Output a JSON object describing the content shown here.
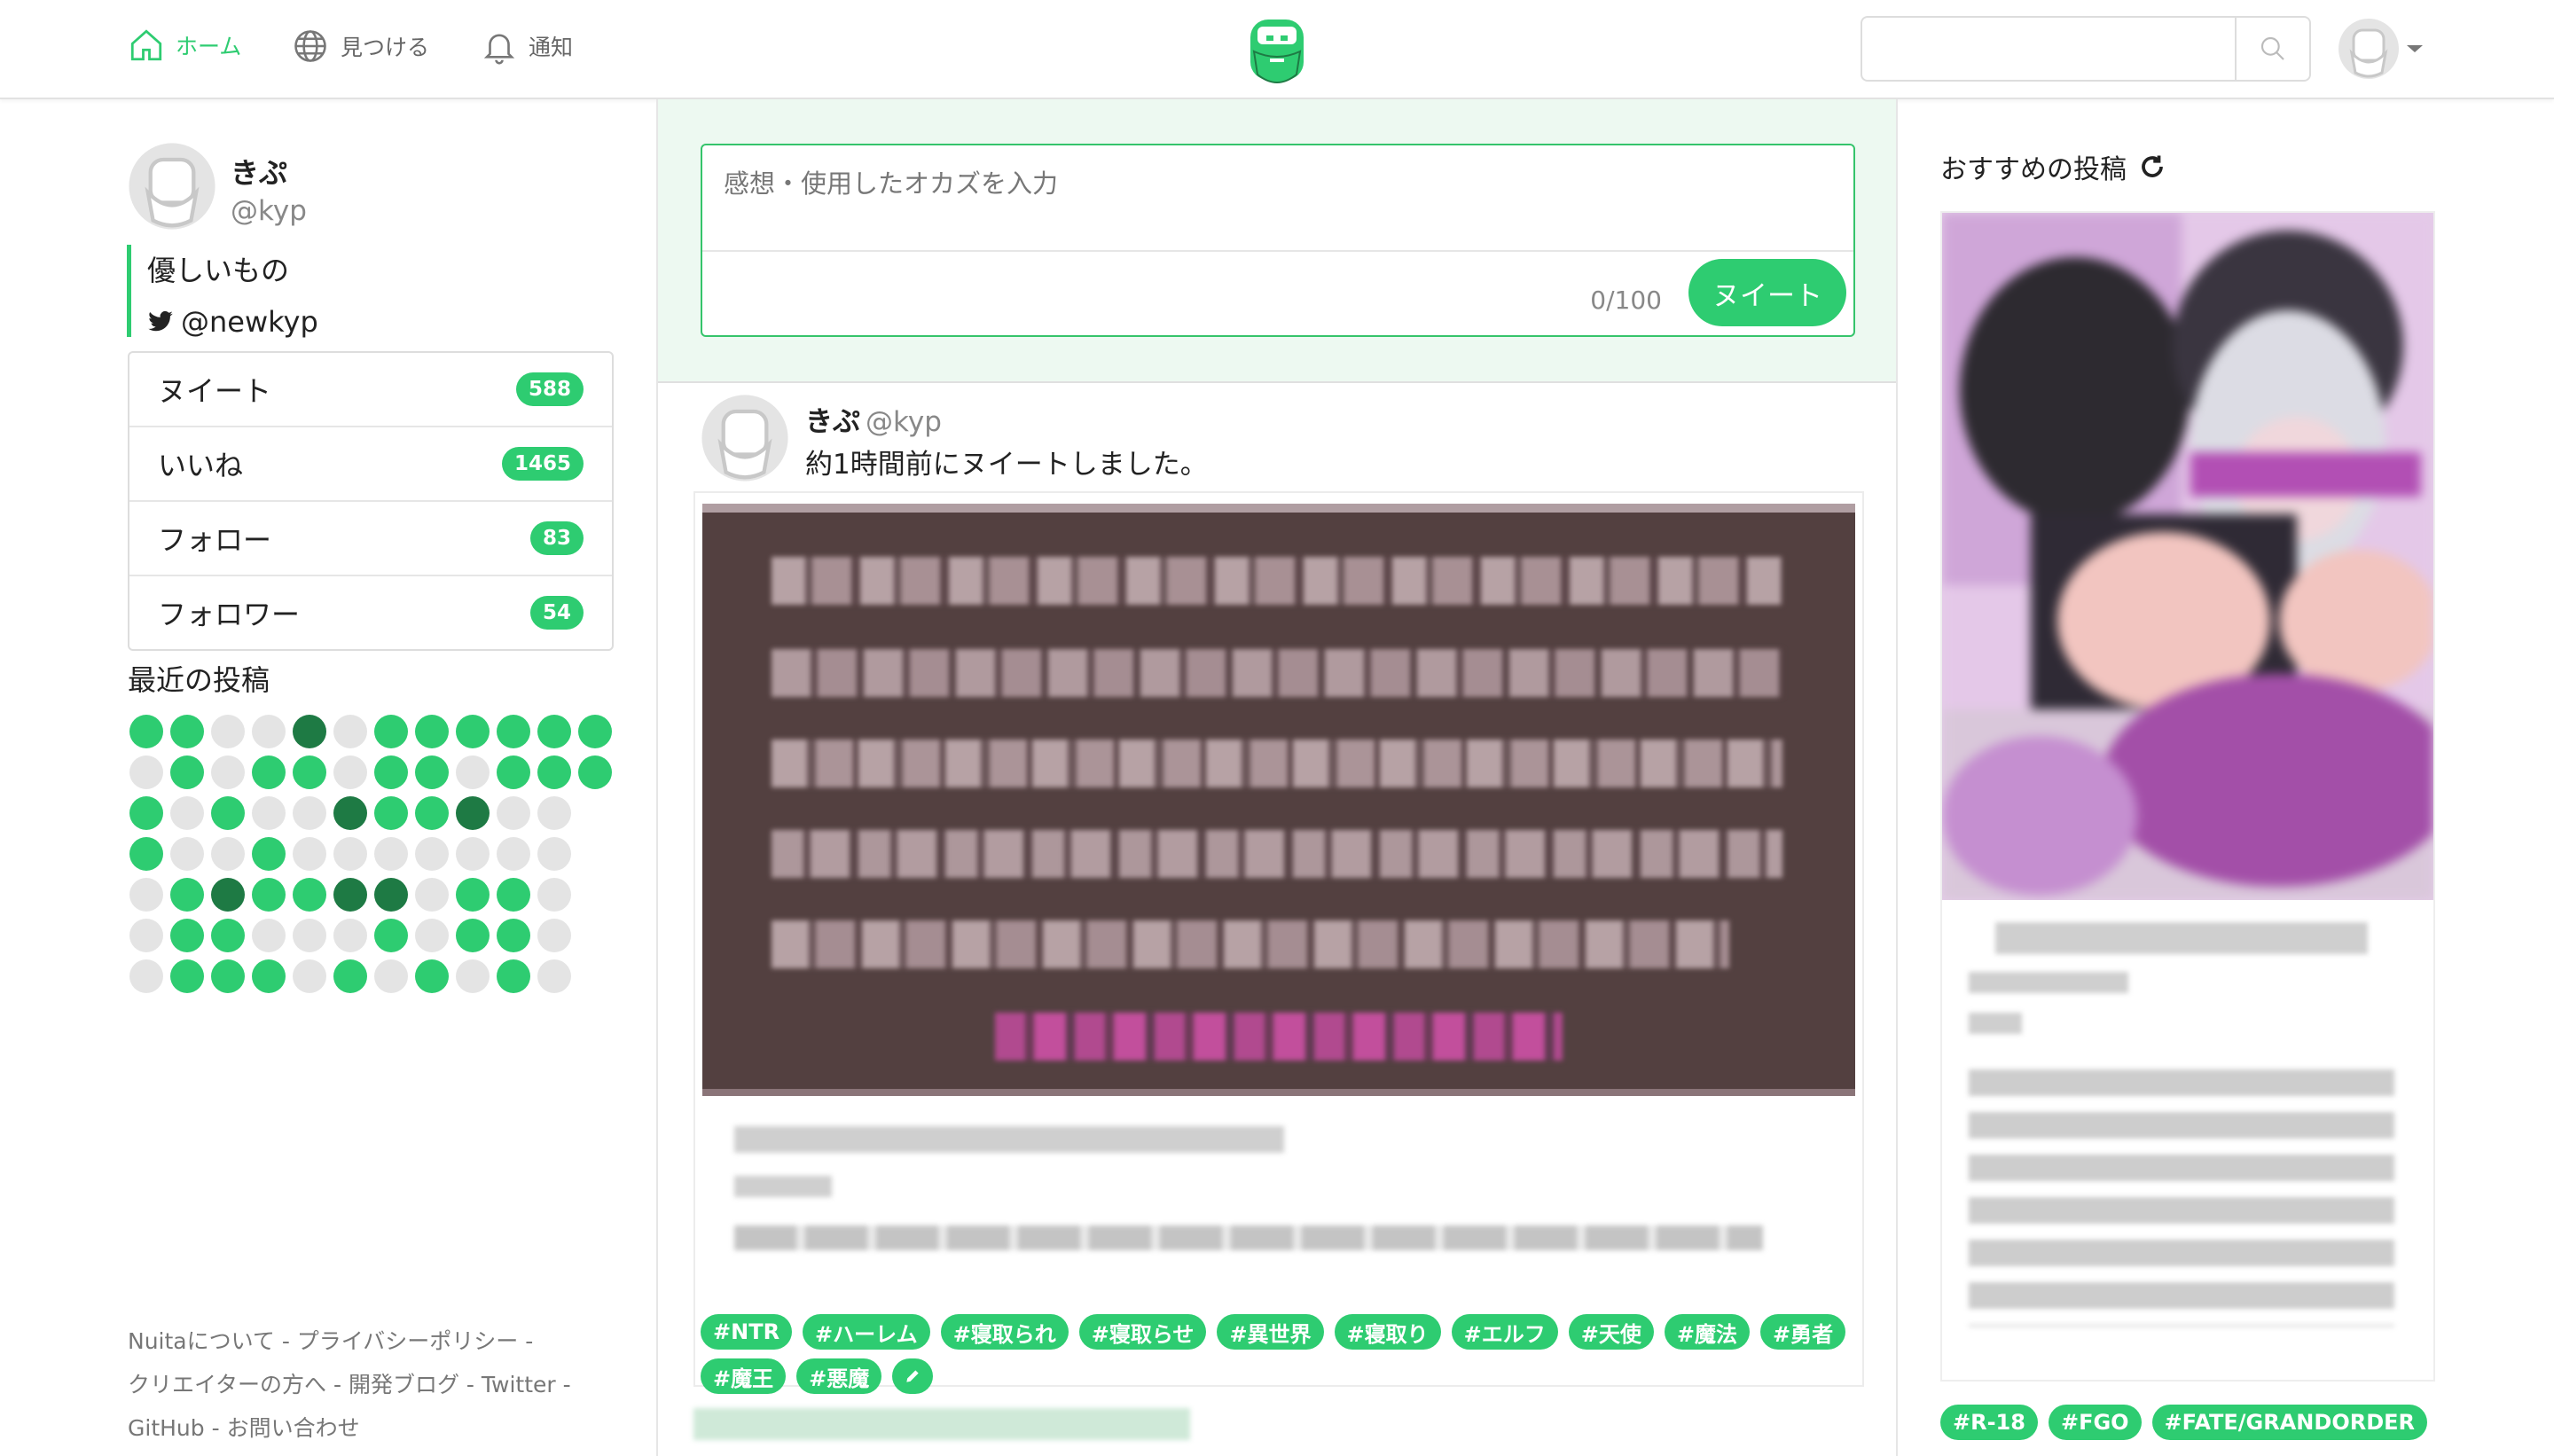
{
  "nav": {
    "home": "ホーム",
    "discover": "見つける",
    "notifications": "通知"
  },
  "search": {
    "placeholder": ""
  },
  "profile": {
    "name": "きぷ",
    "handle": "@kyp",
    "bio_line": "優しいもの",
    "twitter": "@newkyp",
    "stats": [
      {
        "label": "ヌイート",
        "count": "588"
      },
      {
        "label": "いいね",
        "count": "1465"
      },
      {
        "label": "フォロー",
        "count": "83"
      },
      {
        "label": "フォロワー",
        "count": "54"
      }
    ],
    "recent_title": "最近の投稿",
    "activity_rows": [
      "ggeedeggggg",
      "egegg ggegg g",
      "geg ede dgg ee",
      "geegeeeeee",
      "egdggddegge",
      "eggeeegeggee",
      "egggegegeg"
    ]
  },
  "composer": {
    "placeholder": "感想・使用したオカズを入力",
    "counter": "0/100",
    "submit": "ヌイート"
  },
  "post": {
    "name": "きぷ",
    "handle": "@kyp",
    "text": "約1時間前にヌイートしました。",
    "tags": [
      "#NTR",
      "#ハーレム",
      "#寝取られ",
      "#寝取らせ",
      "#異世界",
      "#寝取り",
      "#エルフ",
      "#天使",
      "#魔法",
      "#勇者",
      "#魔王",
      "#悪魔"
    ]
  },
  "recommend": {
    "title": "おすすめの投稿",
    "tags": [
      "#R-18",
      "#FGO",
      "#FATE/GRANDORDER"
    ]
  },
  "footer": {
    "about": "Nuitaについて",
    "privacy": "プライバシーポリシー",
    "creators": "クリエイターの方へ",
    "blog": "開発ブログ",
    "twitter": "Twitter",
    "github": "GitHub",
    "contact": "お問い合わせ",
    "sep": " - "
  },
  "colors": {
    "accent": "#2ecc71",
    "accent_dark": "#1e7a44",
    "panel_bg": "#edf9f1"
  }
}
